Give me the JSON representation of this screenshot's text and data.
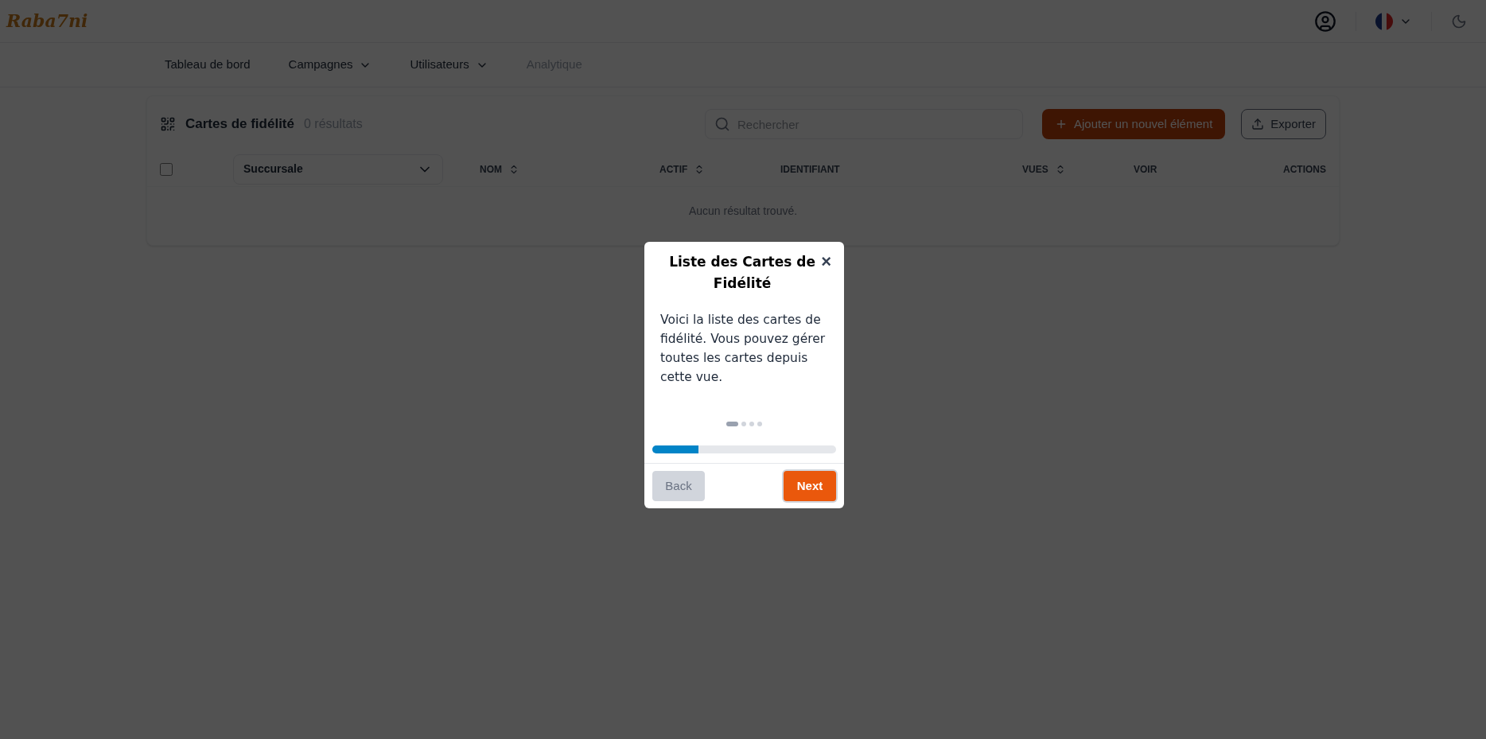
{
  "header": {
    "logo": "Raba7ni"
  },
  "nav": [
    {
      "label": "Tableau de bord",
      "dropdown": false,
      "disabled": false
    },
    {
      "label": "Campagnes",
      "dropdown": true,
      "disabled": false
    },
    {
      "label": "Utilisateurs",
      "dropdown": true,
      "disabled": false
    },
    {
      "label": "Analytique",
      "dropdown": false,
      "disabled": true
    }
  ],
  "card": {
    "title": "Cartes de fidélité",
    "count": "0 résultats",
    "search": {
      "placeholder": "Rechercher"
    },
    "add_button": "Ajouter un nouvel élément",
    "export_button": "Exporter",
    "filter": {
      "value": "Succursale"
    },
    "select_all": {
      "checked": false
    },
    "columns": [
      {
        "label": "NOM",
        "sortable": true
      },
      {
        "label": "ACTIF",
        "sortable": true
      },
      {
        "label": "IDENTIFIANT",
        "sortable": false
      },
      {
        "label": "VUES",
        "sortable": true
      },
      {
        "label": "VOIR",
        "sortable": false
      },
      {
        "label": "ACTIONS",
        "sortable": false
      }
    ],
    "empty": "Aucun résultat trouvé."
  },
  "tour": {
    "title": "Liste des Cartes de Fidélité",
    "close": "×",
    "body": "Voici la liste des cartes de fidélité. Vous pouvez gérer toutes les cartes depuis cette vue.",
    "steps": [
      {
        "selected": true
      },
      {
        "selected": false
      },
      {
        "selected": false
      },
      {
        "selected": false
      }
    ],
    "progress": {
      "level": 0.25
    },
    "back": {
      "label": "Back",
      "disabled": true
    },
    "next": {
      "label": "Next",
      "disabled": false
    }
  }
}
